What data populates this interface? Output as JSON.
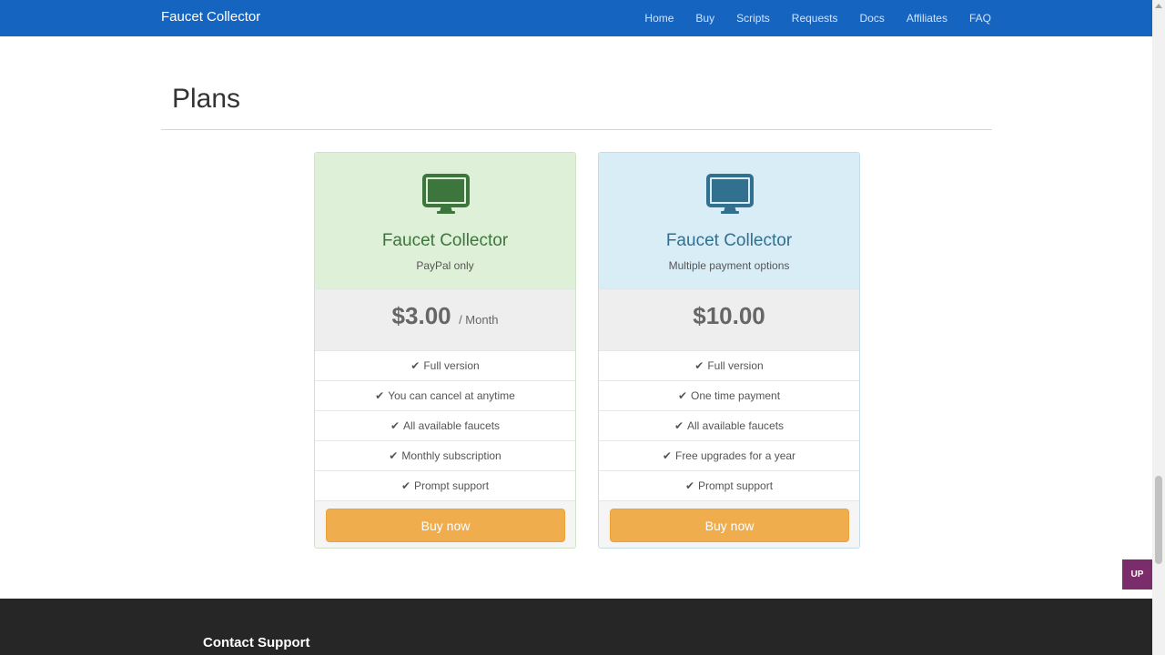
{
  "navbar": {
    "brand": "Faucet Collector",
    "links": [
      "Home",
      "Buy",
      "Scripts",
      "Requests",
      "Docs",
      "Affiliates",
      "FAQ"
    ]
  },
  "page": {
    "title": "Plans"
  },
  "plans": [
    {
      "name": "Faucet Collector",
      "subtitle": "PayPal only",
      "price": "$3.00",
      "period": "/ Month",
      "features": [
        "Full version",
        "You can cancel at anytime",
        "All available faucets",
        "Monthly subscription",
        "Prompt support"
      ],
      "button": "Buy now",
      "icon": "desktop-monitor-icon",
      "color": "#3c763d"
    },
    {
      "name": "Faucet Collector",
      "subtitle": "Multiple payment options",
      "price": "$10.00",
      "period": "",
      "features": [
        "Full version",
        "One time payment",
        "All available faucets",
        "Free upgrades for a year",
        "Prompt support"
      ],
      "button": "Buy now",
      "icon": "desktop-monitor-icon",
      "color": "#31708f"
    }
  ],
  "up_button": "UP",
  "footer": {
    "title": "Contact Support"
  },
  "colors": {
    "navbar": "#1565c0",
    "button": "#f0ad4e",
    "footer": "#262626",
    "up_button": "#7b2d6b"
  }
}
